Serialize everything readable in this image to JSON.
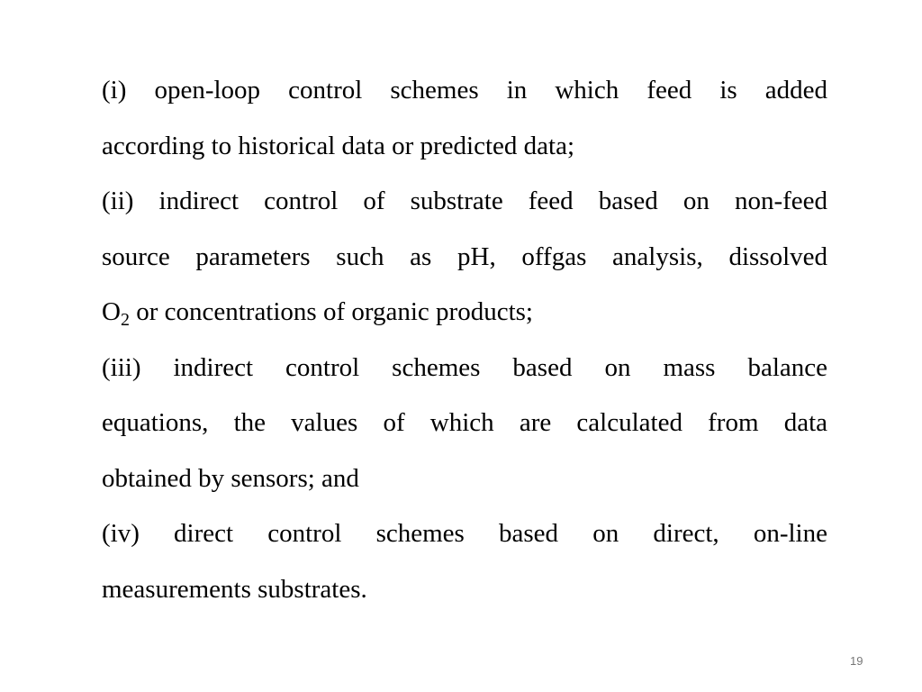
{
  "slide": {
    "items": [
      {
        "marker": "(i)",
        "lines": [
          "(i) open-loop control schemes in which feed is added",
          "according to historical data or predicted data;"
        ]
      },
      {
        "marker": "(ii)",
        "lines": [
          "(ii) indirect control of substrate feed based on non-feed",
          "source parameters such as pH, offgas analysis, dissolved"
        ],
        "o2_line": {
          "base": "O",
          "subscript": "2",
          "rest": " or concentrations of organic products;"
        }
      },
      {
        "marker": "(iii)",
        "lines": [
          "(iii) indirect control schemes based on mass balance",
          "equations, the values of which are calculated from data",
          "obtained by sensors; and"
        ]
      },
      {
        "marker": "(iv)",
        "lines": [
          "(iv) direct control schemes based on direct, on-line",
          "measurements substrates."
        ]
      }
    ],
    "page_number": "19"
  }
}
